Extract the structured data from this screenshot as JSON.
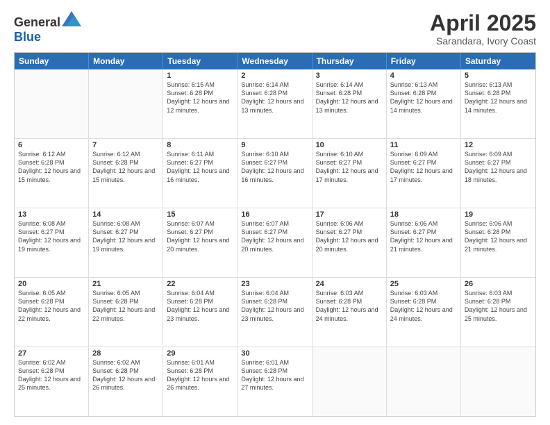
{
  "logo": {
    "text_general": "General",
    "text_blue": "Blue"
  },
  "header": {
    "month": "April 2025",
    "location": "Sarandara, Ivory Coast"
  },
  "days_of_week": [
    "Sunday",
    "Monday",
    "Tuesday",
    "Wednesday",
    "Thursday",
    "Friday",
    "Saturday"
  ],
  "weeks": [
    [
      {
        "day": "",
        "info": ""
      },
      {
        "day": "",
        "info": ""
      },
      {
        "day": "1",
        "info": "Sunrise: 6:15 AM\nSunset: 6:28 PM\nDaylight: 12 hours and 12 minutes."
      },
      {
        "day": "2",
        "info": "Sunrise: 6:14 AM\nSunset: 6:28 PM\nDaylight: 12 hours and 13 minutes."
      },
      {
        "day": "3",
        "info": "Sunrise: 6:14 AM\nSunset: 6:28 PM\nDaylight: 12 hours and 13 minutes."
      },
      {
        "day": "4",
        "info": "Sunrise: 6:13 AM\nSunset: 6:28 PM\nDaylight: 12 hours and 14 minutes."
      },
      {
        "day": "5",
        "info": "Sunrise: 6:13 AM\nSunset: 6:28 PM\nDaylight: 12 hours and 14 minutes."
      }
    ],
    [
      {
        "day": "6",
        "info": "Sunrise: 6:12 AM\nSunset: 6:28 PM\nDaylight: 12 hours and 15 minutes."
      },
      {
        "day": "7",
        "info": "Sunrise: 6:12 AM\nSunset: 6:28 PM\nDaylight: 12 hours and 15 minutes."
      },
      {
        "day": "8",
        "info": "Sunrise: 6:11 AM\nSunset: 6:27 PM\nDaylight: 12 hours and 16 minutes."
      },
      {
        "day": "9",
        "info": "Sunrise: 6:10 AM\nSunset: 6:27 PM\nDaylight: 12 hours and 16 minutes."
      },
      {
        "day": "10",
        "info": "Sunrise: 6:10 AM\nSunset: 6:27 PM\nDaylight: 12 hours and 17 minutes."
      },
      {
        "day": "11",
        "info": "Sunrise: 6:09 AM\nSunset: 6:27 PM\nDaylight: 12 hours and 17 minutes."
      },
      {
        "day": "12",
        "info": "Sunrise: 6:09 AM\nSunset: 6:27 PM\nDaylight: 12 hours and 18 minutes."
      }
    ],
    [
      {
        "day": "13",
        "info": "Sunrise: 6:08 AM\nSunset: 6:27 PM\nDaylight: 12 hours and 19 minutes."
      },
      {
        "day": "14",
        "info": "Sunrise: 6:08 AM\nSunset: 6:27 PM\nDaylight: 12 hours and 19 minutes."
      },
      {
        "day": "15",
        "info": "Sunrise: 6:07 AM\nSunset: 6:27 PM\nDaylight: 12 hours and 20 minutes."
      },
      {
        "day": "16",
        "info": "Sunrise: 6:07 AM\nSunset: 6:27 PM\nDaylight: 12 hours and 20 minutes."
      },
      {
        "day": "17",
        "info": "Sunrise: 6:06 AM\nSunset: 6:27 PM\nDaylight: 12 hours and 20 minutes."
      },
      {
        "day": "18",
        "info": "Sunrise: 6:06 AM\nSunset: 6:27 PM\nDaylight: 12 hours and 21 minutes."
      },
      {
        "day": "19",
        "info": "Sunrise: 6:06 AM\nSunset: 6:28 PM\nDaylight: 12 hours and 21 minutes."
      }
    ],
    [
      {
        "day": "20",
        "info": "Sunrise: 6:05 AM\nSunset: 6:28 PM\nDaylight: 12 hours and 22 minutes."
      },
      {
        "day": "21",
        "info": "Sunrise: 6:05 AM\nSunset: 6:28 PM\nDaylight: 12 hours and 22 minutes."
      },
      {
        "day": "22",
        "info": "Sunrise: 6:04 AM\nSunset: 6:28 PM\nDaylight: 12 hours and 23 minutes."
      },
      {
        "day": "23",
        "info": "Sunrise: 6:04 AM\nSunset: 6:28 PM\nDaylight: 12 hours and 23 minutes."
      },
      {
        "day": "24",
        "info": "Sunrise: 6:03 AM\nSunset: 6:28 PM\nDaylight: 12 hours and 24 minutes."
      },
      {
        "day": "25",
        "info": "Sunrise: 6:03 AM\nSunset: 6:28 PM\nDaylight: 12 hours and 24 minutes."
      },
      {
        "day": "26",
        "info": "Sunrise: 6:03 AM\nSunset: 6:28 PM\nDaylight: 12 hours and 25 minutes."
      }
    ],
    [
      {
        "day": "27",
        "info": "Sunrise: 6:02 AM\nSunset: 6:28 PM\nDaylight: 12 hours and 25 minutes."
      },
      {
        "day": "28",
        "info": "Sunrise: 6:02 AM\nSunset: 6:28 PM\nDaylight: 12 hours and 26 minutes."
      },
      {
        "day": "29",
        "info": "Sunrise: 6:01 AM\nSunset: 6:28 PM\nDaylight: 12 hours and 26 minutes."
      },
      {
        "day": "30",
        "info": "Sunrise: 6:01 AM\nSunset: 6:28 PM\nDaylight: 12 hours and 27 minutes."
      },
      {
        "day": "",
        "info": ""
      },
      {
        "day": "",
        "info": ""
      },
      {
        "day": "",
        "info": ""
      }
    ]
  ]
}
